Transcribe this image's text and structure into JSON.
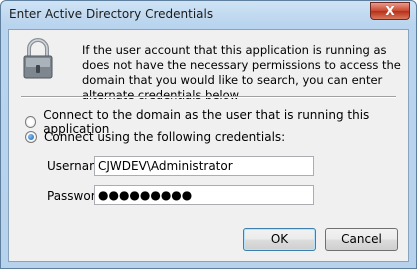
{
  "window": {
    "title": "Enter Active Directory Credentials",
    "close_glyph": "X"
  },
  "info_text": "If the user account that this application is running as does not have the necessary permissions to access the domain that you would like to search, you can enter alternate credentials below",
  "options": [
    {
      "label": "Connect to the domain as the user that is running this application",
      "checked": false
    },
    {
      "label": "Connect using the following credentials:",
      "checked": true
    }
  ],
  "form": {
    "username_label": "Username:",
    "username_value": "CJWDEV\\Administrator",
    "password_label": "Password:",
    "password_value": "●●●●●●●●●"
  },
  "buttons": {
    "ok": "OK",
    "cancel": "Cancel"
  },
  "icons": {
    "lock": "lock-icon",
    "close": "close-icon"
  }
}
